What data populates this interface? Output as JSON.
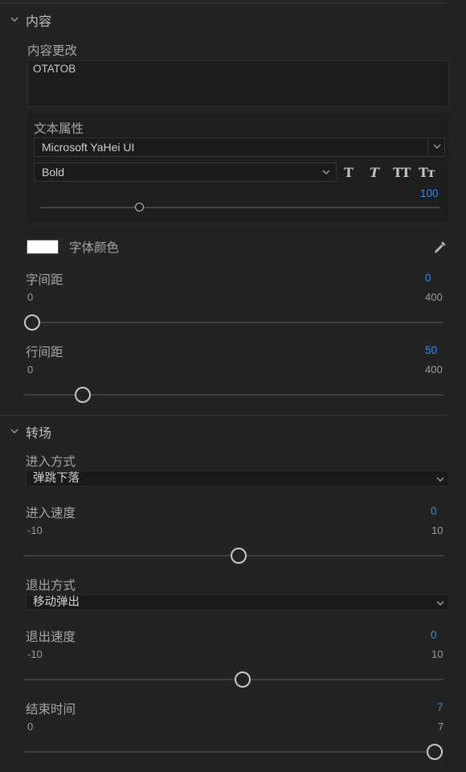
{
  "content_section": {
    "title": "内容",
    "content_change": {
      "label": "内容更改",
      "value": "OTATOB"
    },
    "text_properties": {
      "label": "文本属性",
      "font_family": "Microsoft YaHei UI",
      "font_style": "Bold",
      "style_buttons": [
        "T",
        "T",
        "TT",
        "Tт"
      ],
      "font_size": "100",
      "font_size_fraction": 0.25
    },
    "font_color": {
      "label": "字体颜色",
      "color": "#ffffff"
    },
    "letter_spacing": {
      "label": "字间距",
      "value": "0",
      "min": "0",
      "max": "400"
    },
    "line_spacing": {
      "label": "行间距",
      "value": "50",
      "min": "0",
      "max": "400"
    }
  },
  "transition_section": {
    "title": "转场",
    "enter_mode": {
      "label": "进入方式",
      "value": "弹跳下落"
    },
    "enter_speed": {
      "label": "进入速度",
      "value": "0",
      "min": "-10",
      "max": "10"
    },
    "exit_mode": {
      "label": "退出方式",
      "value": "移动弹出"
    },
    "exit_speed": {
      "label": "退出速度",
      "value": "0",
      "min": "-10",
      "max": "10"
    },
    "end_time": {
      "label": "结束时间",
      "value": "7",
      "min": "0",
      "max": "7"
    }
  },
  "icons": {
    "collapse": "chevron-down-icon",
    "dropdown": "chevron-down-icon",
    "eyedropper": "eyedropper-icon"
  },
  "colors": {
    "background": "#232323",
    "accent_value": "#2d8ceb",
    "panel": "#1e1e1e"
  }
}
